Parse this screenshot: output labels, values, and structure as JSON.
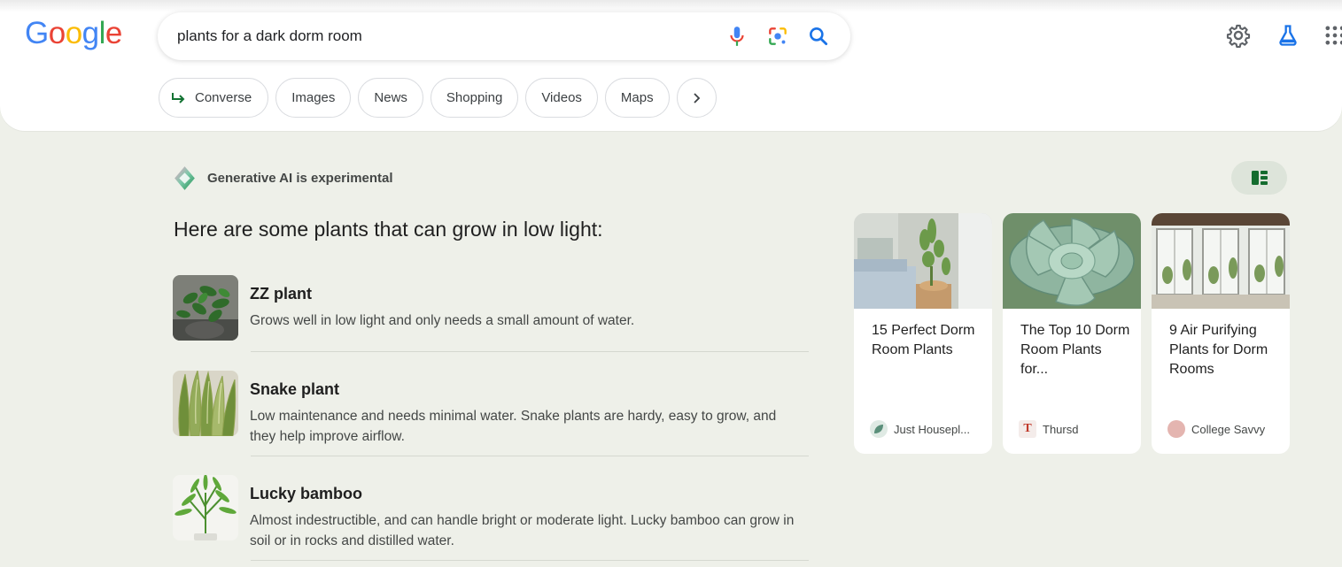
{
  "logo": {
    "letters": [
      {
        "char": "G",
        "color": "#4285F4"
      },
      {
        "char": "o",
        "color": "#EA4335"
      },
      {
        "char": "o",
        "color": "#FBBC05"
      },
      {
        "char": "g",
        "color": "#4285F4"
      },
      {
        "char": "l",
        "color": "#34A853"
      },
      {
        "char": "e",
        "color": "#EA4335"
      }
    ]
  },
  "search": {
    "query": "plants for a dark dorm room",
    "icons": [
      "microphone-icon",
      "lens-icon",
      "search-icon"
    ]
  },
  "header_icons": [
    "gear-icon",
    "labs-flask-icon",
    "apps-grid-icon"
  ],
  "chips": [
    {
      "label": "Converse",
      "icon": "converse-arrow-icon"
    },
    {
      "label": "Images"
    },
    {
      "label": "News"
    },
    {
      "label": "Shopping"
    },
    {
      "label": "Videos"
    },
    {
      "label": "Maps"
    }
  ],
  "more_chip_icon": "chevron-right-icon",
  "ai": {
    "label": "Generative AI is experimental",
    "heading": "Here are some plants that can grow in low light:",
    "toggle_icon": "layout-toggle-icon"
  },
  "plants": [
    {
      "name": "ZZ plant",
      "description": "Grows well in low light and only needs a small amount of water."
    },
    {
      "name": "Snake plant",
      "description": "Low maintenance and needs minimal water. Snake plants are hardy, easy to grow, and they help improve airflow."
    },
    {
      "name": "Lucky bamboo",
      "description": "Almost indestructible, and can handle bright or moderate light. Lucky bamboo can grow in soil or in rocks and distilled water."
    }
  ],
  "cards": [
    {
      "title": "15 Perfect Dorm Room Plants",
      "source": "Just Housepl...",
      "favicon_color": "#5a8f7a"
    },
    {
      "title": "The Top 10 Dorm Room Plants for...",
      "source": "Thursd",
      "favicon_letter": "T",
      "favicon_color": "#c0392b"
    },
    {
      "title": "9 Air Purifying Plants for Dorm Rooms",
      "source": "College Savvy",
      "favicon_color": "#e4b5b0"
    }
  ],
  "colors": {
    "background": "#eef0e9",
    "accent_blue": "#1a73e8",
    "toggle_bg": "#dde4da",
    "toggle_icon": "#146c2e"
  }
}
